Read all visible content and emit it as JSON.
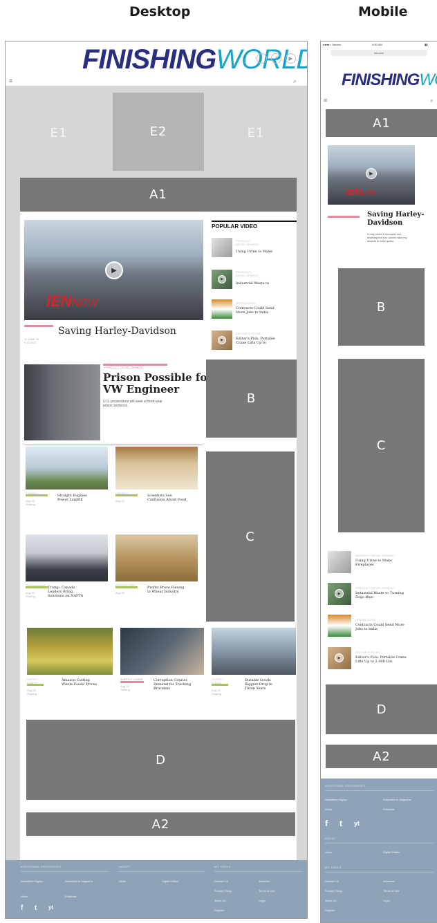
{
  "headings": {
    "desktop": "Desktop",
    "mobile": "Mobile"
  },
  "brand": {
    "logo_part1": "FINISHING",
    "logo_part2": "WORLD",
    "logo_color1": "#2a2e7e",
    "logo_color2": "#1aa3c9"
  },
  "slots": {
    "e1": "E1",
    "e2": "E2",
    "a1": "A1",
    "a2": "A2",
    "b": "B",
    "c": "C",
    "d": "D"
  },
  "video_badge": {
    "main": "IEN",
    "suffix": "NOW"
  },
  "desktop": {
    "hero_headline": "Saving Harley-Davidson",
    "hero_meta": "11 JUNE 30\n9 10.2021",
    "popular_title": "POPULAR VIDEO",
    "popular": [
      {
        "cat": "PRODUCT\nDEVELOPMENT",
        "title": "Using Urine to Make"
      },
      {
        "cat": "PRODUCT\nDEVELOPMENT",
        "title": "Industrial Waste to"
      },
      {
        "cat": "OPERATIONS",
        "title": "Contracts Could Send\nMore Jobs to India"
      },
      {
        "cat": "EDITOR'S PICKS",
        "title": "Editor's Pick: Portable\nCrane Lifts Up to"
      }
    ],
    "feature_cat": "PRODUCT DEVELOPMENT",
    "feature_headline": "Prison Possible for\nVW Engineer",
    "feature_sub": "U.S. prosecutors will seek a three-year\nprison sentence.",
    "grid1": [
      {
        "cat": "ENERGY",
        "title": "Straight Engines\nPower Landfill",
        "meta": "Aug 25\nSharing"
      },
      {
        "cat": "ENERGY",
        "title": "Scientists See\nConfusion About Food",
        "meta": "Aug 25"
      }
    ],
    "grid2": [
      {
        "cat": "OPERATIONS",
        "title": "Trump, Canada\nLeaders Bring\nSolutions on NAFTA",
        "meta": "Aug 25\nSharing"
      },
      {
        "cat": "OPERATIONS",
        "title": "Profits Prove Flexing\nin Wheat Industry",
        "meta": "Aug 25"
      }
    ],
    "grid3": [
      {
        "cat": "SUPPLY\nCHAIN",
        "title": "Amazon Cutting\nWhole Foods' Prices",
        "meta": "Aug 25\nSharing"
      },
      {
        "cat": "SUPPLY CHAIN",
        "title": "Corruption Creates\nDemand for Tracking\nBracelets",
        "meta": "Aug 25\nSharing"
      },
      {
        "cat": "SUPPLY\nCHAIN",
        "title": "Durable Goods\nBiggest Drop in\nThree Years",
        "meta": "Aug 25\nSharing"
      }
    ],
    "footer": {
      "col1_title": "ADDITIONAL RESOURCES",
      "col2_title": "ABOUT",
      "col3_title": "MY TOOLS",
      "col1_links": [
        "Newsletter Signup",
        "Subscribe to Magazine",
        "Video",
        "Editorials"
      ],
      "col2_links": [
        "Video",
        "Digital Edition"
      ],
      "col3_links": [
        "Contact Us",
        "Advertise",
        "Privacy Policy",
        "Terms of Use",
        "About Us",
        "Login",
        "Register"
      ],
      "social": [
        "f",
        "t",
        "yt"
      ]
    }
  },
  "mobile": {
    "status_left": "●●●●○ Verizon",
    "status_time": "9:00 AM",
    "url": "ien.com",
    "hero_headline": "Saving Harley-\nDavidson",
    "hero_sub": "It may seem it shouldn't sell,\nanything but you cannot take my\nmiracle of ethic quest.",
    "list": [
      {
        "cat": "PRODUCT DEVELOPMENT",
        "title": "Using Urine to Make\nFireplaces"
      },
      {
        "cat": "PRODUCT DEVELOPMENT",
        "title": "Industrial Waste to Turning\nDogs Blue"
      },
      {
        "cat": "OPERATIONS",
        "title": "Contracts Could Send More\nJobs to India"
      },
      {
        "cat": "EDITOR'S PICKS",
        "title": "Editor's Pick: Portable Crane\nLifts Up to 2,000 Lbs"
      }
    ],
    "footer": {
      "title1": "ADDITIONAL RESOURCES",
      "links1": [
        "Newsletter Signup",
        "Subscribe to Magazine",
        "Video",
        "Editorials"
      ],
      "title2": "ABOUT",
      "links2": [
        "Video",
        "Digital Edition"
      ],
      "title3": "MY TOOLS",
      "links3": [
        "Contact Us",
        "Advertise",
        "Privacy Policy",
        "Terms of Use",
        "About Us",
        "Login",
        "Register"
      ]
    }
  }
}
